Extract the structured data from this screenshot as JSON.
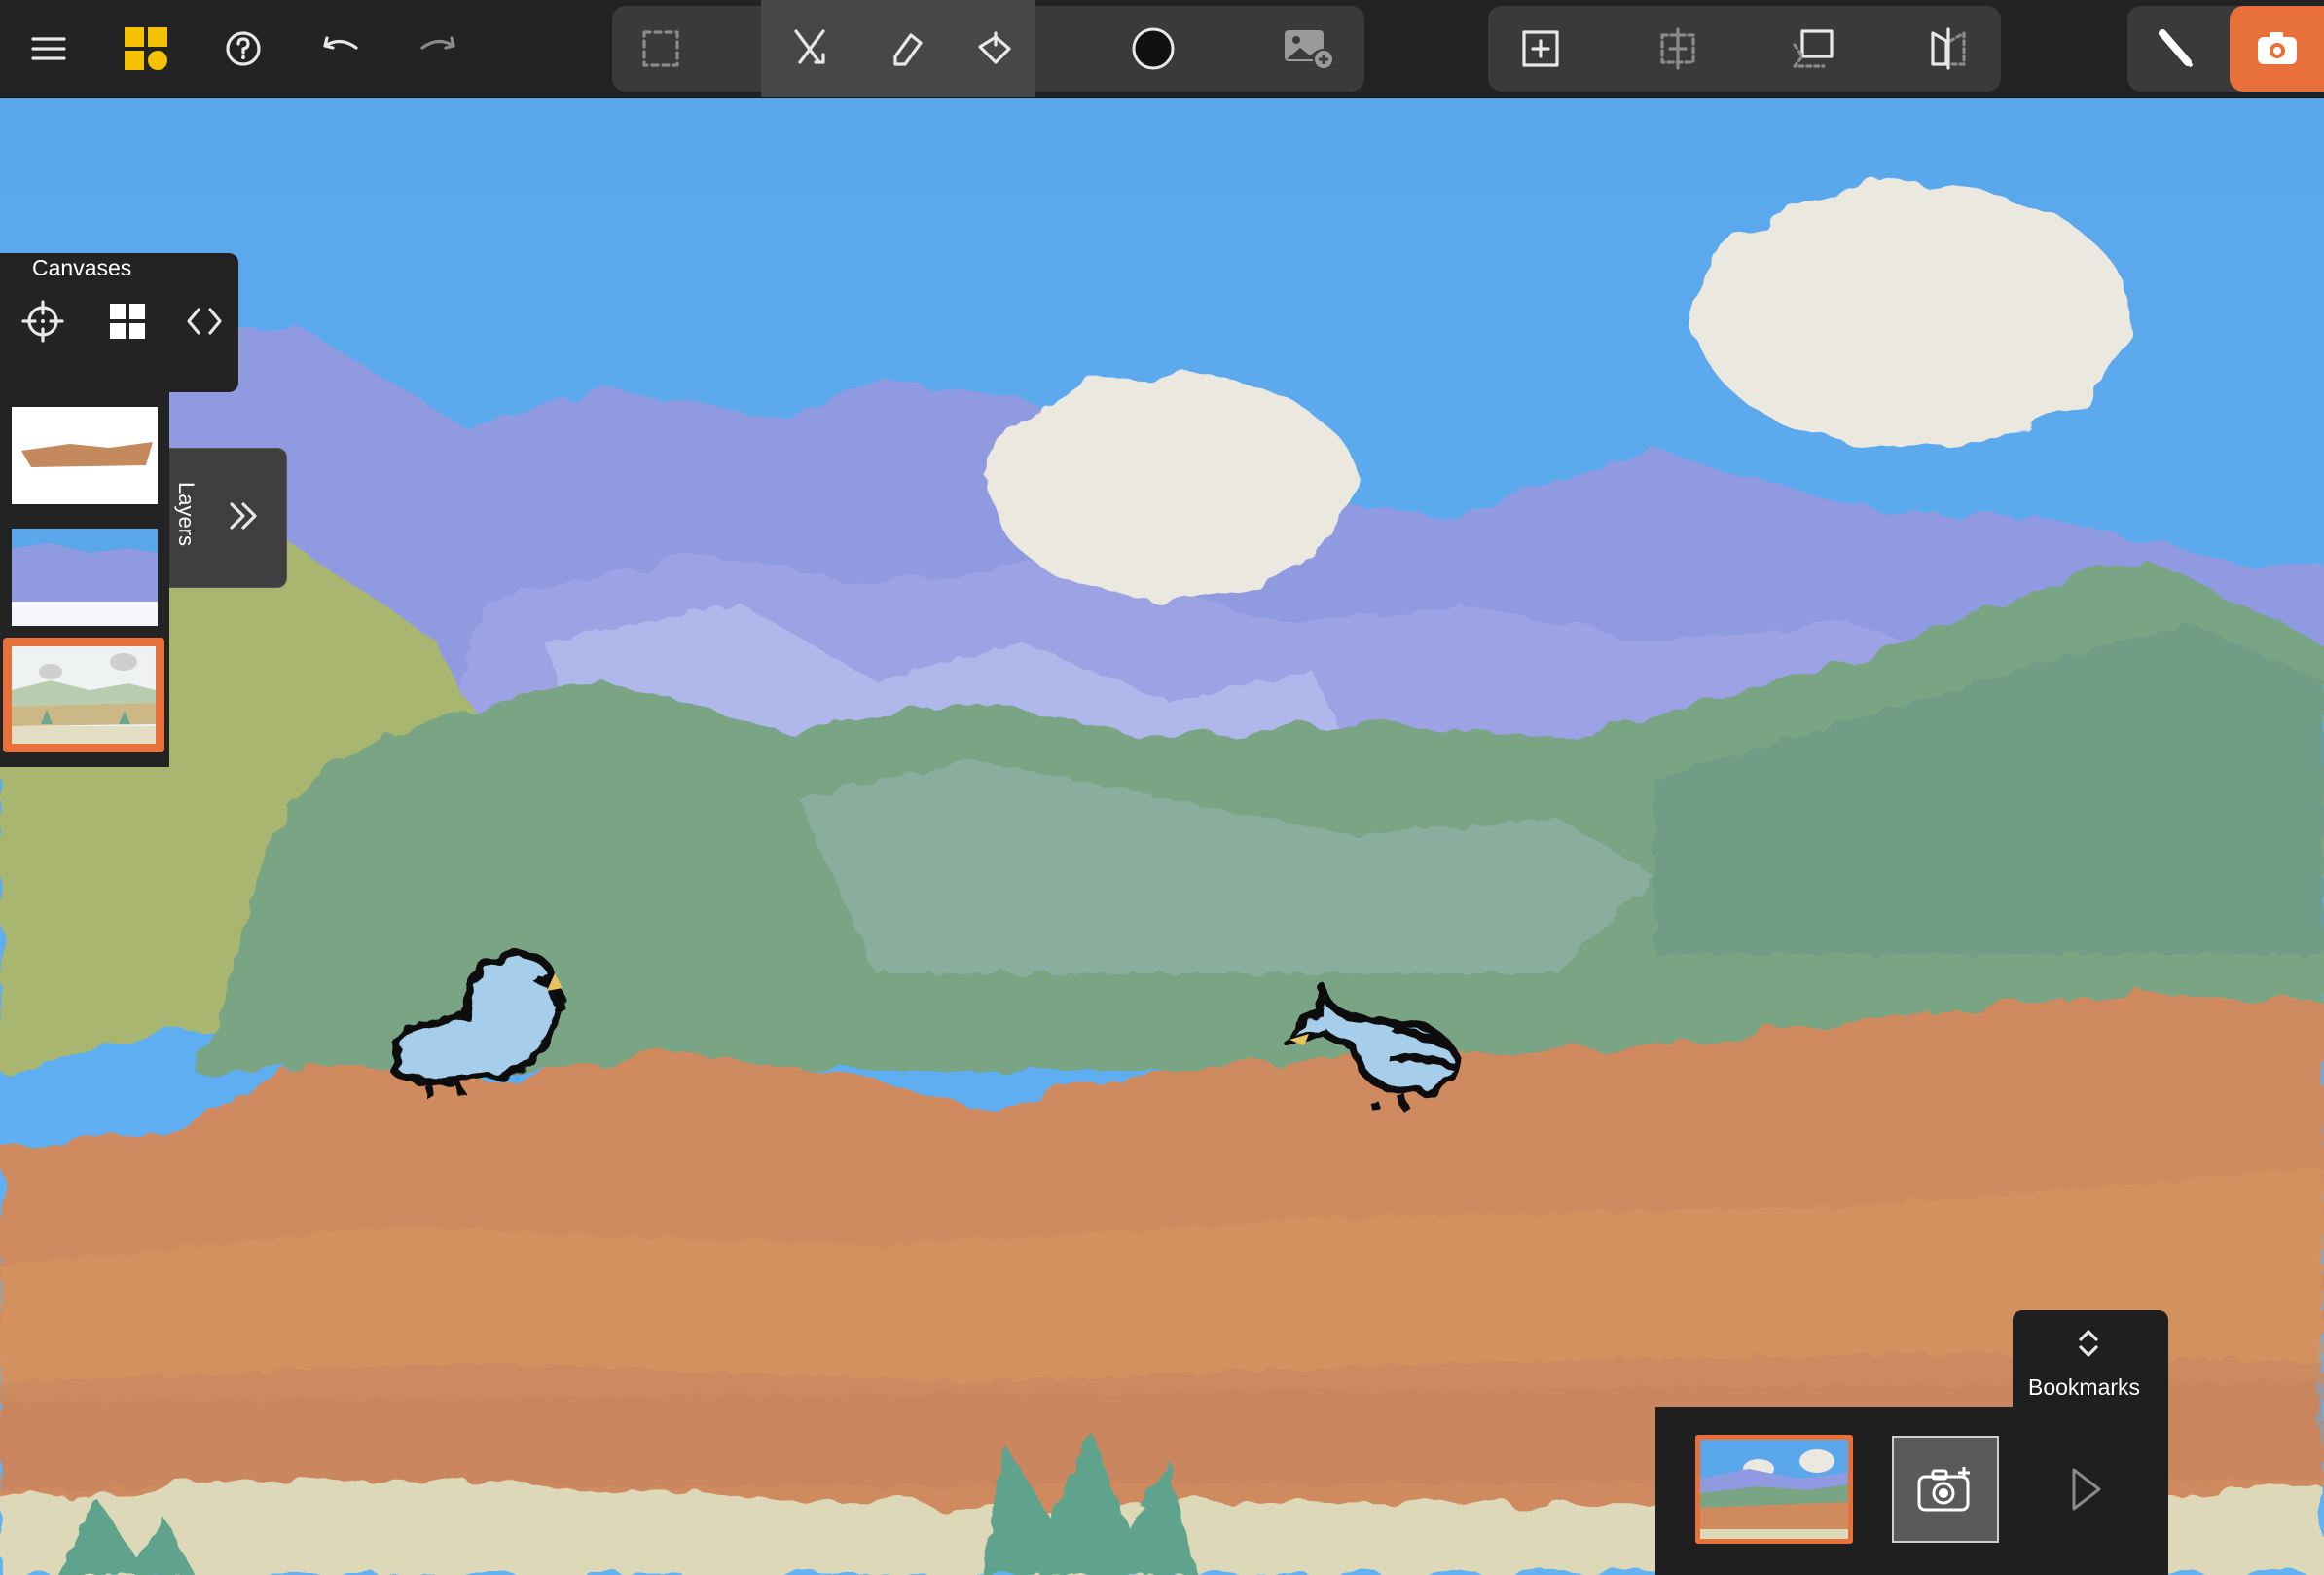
{
  "toolbar": {
    "left": [
      "menu-icon",
      "app-logo-icon",
      "help-icon",
      "undo-icon",
      "redo-icon"
    ],
    "tools": [
      "selection-icon",
      "brush-icon",
      "eraser-icon",
      "fill-icon",
      "color-circle-icon",
      "insert-image-icon"
    ],
    "canvas_tools": [
      "add-canvas-icon",
      "resize-canvas-icon",
      "transform-icon",
      "flip-icon"
    ],
    "right": [
      "pencil-mode-icon",
      "camera-icon"
    ],
    "accent": "#e8703a"
  },
  "canvases_panel": {
    "title": "Canvases",
    "icons": [
      "crosshair-icon",
      "grid-icon",
      "code-brackets-icon"
    ]
  },
  "layers": {
    "label": "Layers",
    "expand_icon": "double-chevron-right-icon",
    "items": [
      "layer-ground",
      "layer-sky",
      "layer-full-scene"
    ],
    "selected_index": 2
  },
  "bookmarks": {
    "label": "Bookmarks",
    "toggle_icon": "chevron-up-down-icon",
    "add_icon": "camera-plus-icon",
    "play_icon": "play-icon"
  }
}
